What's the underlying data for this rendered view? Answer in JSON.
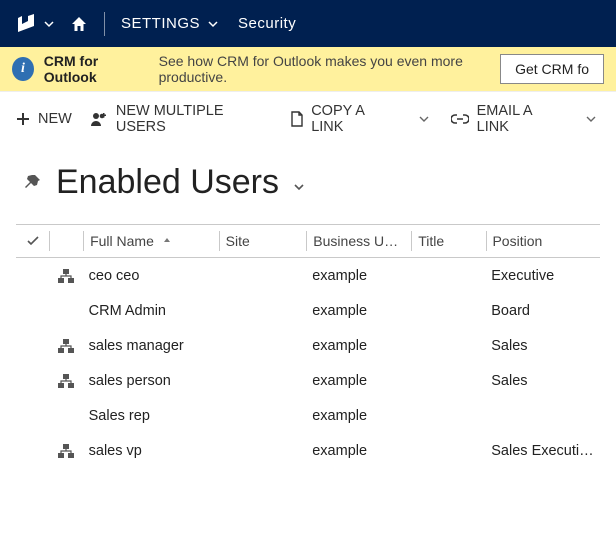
{
  "nav": {
    "settings_label": "SETTINGS",
    "breadcrumb": "Security"
  },
  "notice": {
    "title": "CRM for Outlook",
    "text": "See how CRM for Outlook makes you even more productive.",
    "button": "Get CRM fo"
  },
  "commands": {
    "new": "NEW",
    "new_multiple": "NEW MULTIPLE USERS",
    "copy_link": "COPY A LINK",
    "email_link": "EMAIL A LINK"
  },
  "view": {
    "title": "Enabled Users"
  },
  "grid": {
    "columns": {
      "full_name": "Full Name",
      "site": "Site",
      "business_unit": "Business Unit…",
      "title": "Title",
      "position": "Position"
    },
    "rows": [
      {
        "hier": true,
        "name": "ceo ceo",
        "site": "",
        "bu": "example",
        "title": "",
        "pos": "Executive"
      },
      {
        "hier": false,
        "name": "CRM Admin",
        "site": "",
        "bu": "example",
        "title": "",
        "pos": "Board"
      },
      {
        "hier": true,
        "name": "sales manager",
        "site": "",
        "bu": "example",
        "title": "",
        "pos": "Sales"
      },
      {
        "hier": true,
        "name": "sales person",
        "site": "",
        "bu": "example",
        "title": "",
        "pos": "Sales"
      },
      {
        "hier": false,
        "name": "Sales rep",
        "site": "",
        "bu": "example",
        "title": "",
        "pos": ""
      },
      {
        "hier": true,
        "name": "sales vp",
        "site": "",
        "bu": "example",
        "title": "",
        "pos": "Sales Executives"
      }
    ]
  }
}
